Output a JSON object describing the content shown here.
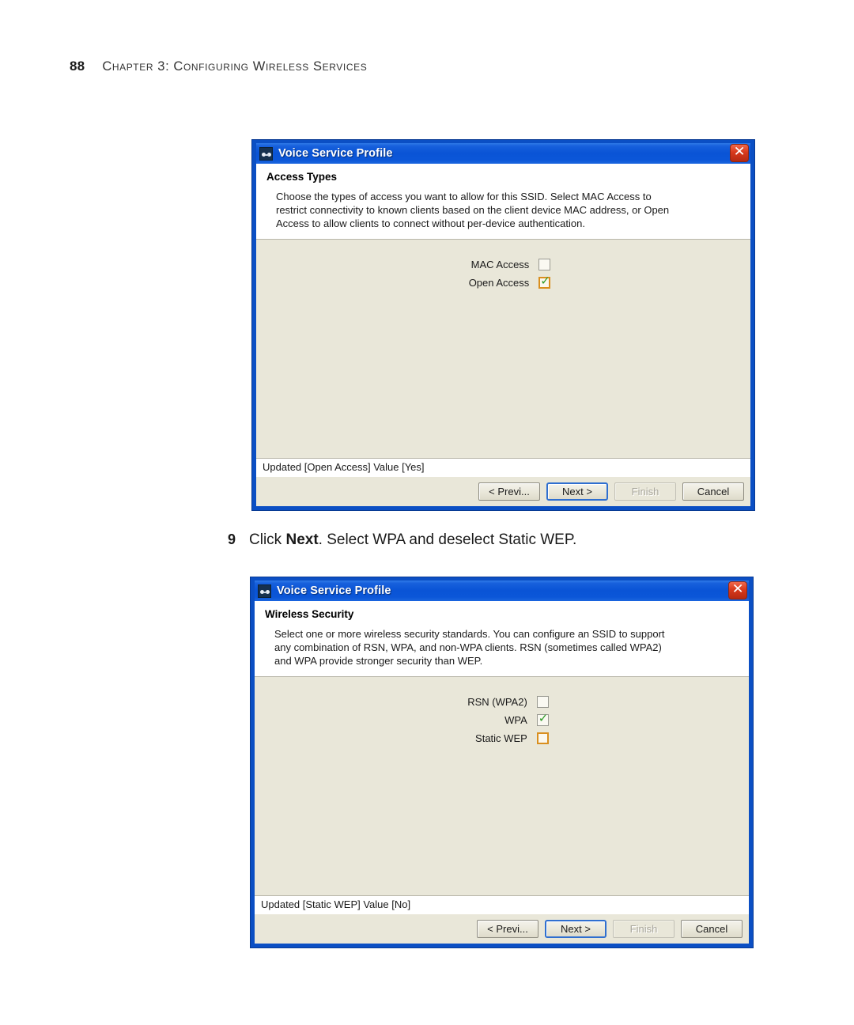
{
  "page": {
    "number": "88",
    "chapter_title": "Chapter 3: Configuring Wireless Services"
  },
  "step": {
    "number": "9",
    "text_before": "Click ",
    "bold": "Next",
    "text_after": ". Select WPA and deselect Static WEP."
  },
  "dialogs": [
    {
      "title": "Voice Service Profile",
      "icon": "wireless-profile-icon",
      "close_label": "✕",
      "header_title": "Access Types",
      "description_lines": [
        "Choose the types of access you want to allow for this SSID. Select MAC Access to",
        "restrict connectivity to known clients based on the client device MAC address, or Open",
        "Access to allow clients to connect without per-device authentication."
      ],
      "checkboxes": [
        {
          "label": "MAC Access",
          "checked": false,
          "focused": false
        },
        {
          "label": "Open Access",
          "checked": true,
          "focused": true
        }
      ],
      "status": "Updated [Open Access] Value [Yes]",
      "buttons": [
        {
          "label": "< Previ...",
          "state": "normal"
        },
        {
          "label": "Next >",
          "state": "default"
        },
        {
          "label": "Finish",
          "state": "disabled"
        },
        {
          "label": "Cancel",
          "state": "normal"
        }
      ]
    },
    {
      "title": "Voice Service Profile",
      "icon": "wireless-profile-icon",
      "close_label": "✕",
      "header_title": "Wireless Security",
      "description_lines": [
        "Select one or more wireless security standards. You can configure an SSID to support",
        "any combination of RSN, WPA, and non-WPA clients. RSN (sometimes called WPA2)",
        "and WPA provide stronger security than WEP."
      ],
      "checkboxes": [
        {
          "label": "RSN (WPA2)",
          "checked": false,
          "focused": false
        },
        {
          "label": "WPA",
          "checked": true,
          "focused": false
        },
        {
          "label": "Static WEP",
          "checked": false,
          "focused": true
        }
      ],
      "status": "Updated [Static WEP] Value [No]",
      "buttons": [
        {
          "label": "< Previ...",
          "state": "normal"
        },
        {
          "label": "Next >",
          "state": "default"
        },
        {
          "label": "Finish",
          "state": "disabled"
        },
        {
          "label": "Cancel",
          "state": "normal"
        }
      ]
    }
  ],
  "colors": {
    "titlebar_blue": "#0a54d6",
    "dialog_border": "#0b4fc4",
    "panel_beige": "#e9e7d9",
    "check_green": "#2f9b28",
    "focus_orange": "#d98f1f",
    "close_red": "#d8391c"
  }
}
